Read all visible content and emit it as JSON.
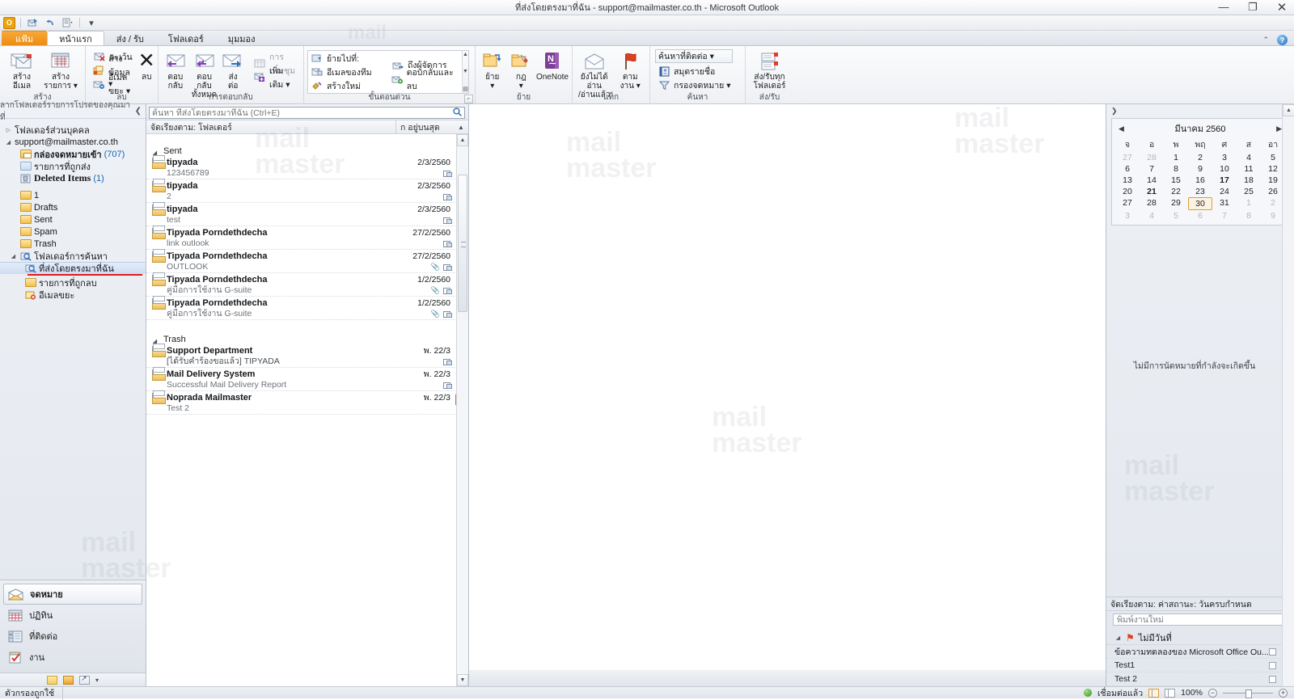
{
  "window": {
    "title": "ที่ส่งโดยตรงมาที่ฉัน - support@mailmaster.co.th - Microsoft Outlook",
    "minimize": "—",
    "maximize": "❐",
    "close": "✕",
    "help": "?",
    "ribbon_collapse": "⌃"
  },
  "qat": {
    "logo": "O",
    "save_icon": "save-icon",
    "undo_icon": "undo-icon",
    "sendreceive_icon": "send-receive-icon",
    "customize_icon": "customize-icon"
  },
  "tabs": [
    {
      "label": "แฟ้ม",
      "type": "file"
    },
    {
      "label": "หน้าแรก",
      "type": "active"
    },
    {
      "label": "ส่ง / รับ",
      "type": "normal"
    },
    {
      "label": "โฟลเดอร์",
      "type": "normal"
    },
    {
      "label": "มุมมอง",
      "type": "normal"
    }
  ],
  "ribbon": {
    "groups": [
      {
        "name": "สร้าง",
        "big": [
          {
            "label": "สร้าง\nอีเมล",
            "icon": "new-email-icon"
          },
          {
            "label": "สร้าง\nรายการ ▾",
            "icon": "new-items-icon"
          }
        ]
      },
      {
        "name": "ลบ",
        "small": [
          {
            "label": "ละเว้น",
            "icon": "ignore-icon"
          },
          {
            "label": "ล้างข้อมูล ▾",
            "icon": "cleanup-icon"
          },
          {
            "label": "อีเมลขยะ ▾",
            "icon": "junk-icon"
          }
        ],
        "big": [
          {
            "label": "ลบ",
            "icon": "delete-icon"
          }
        ]
      },
      {
        "name": "การตอบกลับ",
        "big": [
          {
            "label": "ตอบ\nกลับ",
            "icon": "reply-icon"
          },
          {
            "label": "ตอบกลับ\nทั้งหมด",
            "icon": "reply-all-icon"
          },
          {
            "label": "ส่ง\nต่อ",
            "icon": "forward-icon"
          }
        ],
        "small": [
          {
            "label": "การประชุม",
            "icon": "meeting-icon"
          },
          {
            "label": "เพิ่มเติม ▾",
            "icon": "more-icon"
          }
        ]
      },
      {
        "name": "ขั้นตอนด่วน",
        "quick_steps": [
          {
            "label": "ย้ายไปที่:",
            "icon": "move-to-icon"
          },
          {
            "label": "อีเมลของทีม",
            "icon": "team-email-icon"
          },
          {
            "label": "สร้างใหม่",
            "icon": "new-quickstep-icon"
          },
          {
            "label": "ถึงผู้จัดการ",
            "icon": "to-manager-icon"
          },
          {
            "label": "ตอบกลับและลบ",
            "icon": "reply-delete-icon"
          }
        ]
      },
      {
        "name": "ย้าย",
        "big": [
          {
            "label": "ย้าย\n▾",
            "icon": "move-icon"
          },
          {
            "label": "กฎ\n▾",
            "icon": "rules-icon"
          },
          {
            "label": "OneNote",
            "icon": "onenote-icon"
          }
        ]
      },
      {
        "name": "แท็ก",
        "big": [
          {
            "label": "ยังไม่ได้อ่าน\n/อ่านแล้ว",
            "icon": "unread-read-icon"
          },
          {
            "label": "ตาม\nงาน ▾",
            "icon": "follow-up-icon"
          }
        ]
      },
      {
        "name": "ค้นหา",
        "small": [
          {
            "label": "ค้นหาที่ติดต่อ ▾",
            "icon": "find-contact-icon"
          },
          {
            "label": "สมุดรายชื่อ",
            "icon": "address-book-icon"
          },
          {
            "label": "กรองจดหมาย ▾",
            "icon": "filter-email-icon"
          }
        ]
      },
      {
        "name": "ส่ง/รับ",
        "big": [
          {
            "label": "ส่ง/รับทุก\nโฟลเดอร์",
            "icon": "send-receive-all-icon"
          }
        ]
      }
    ]
  },
  "navpane": {
    "header": "ลากโฟลเดอร์รายการโปรดของคุณมาที่",
    "collapse": "❮",
    "tree": [
      {
        "label": "โฟลเดอร์ส่วนบุคคล",
        "indent": 0,
        "twisty": "▷",
        "icon": "none",
        "bold": false
      },
      {
        "label": "support@mailmaster.co.th",
        "indent": 0,
        "twisty": "◢",
        "icon": "none",
        "bold": false
      },
      {
        "label": "กล่องจดหมายเข้า",
        "count": "(707)",
        "indent": 1,
        "icon": "inbox-folder-icon",
        "bold": true
      },
      {
        "label": "รายการที่ถูกส่ง",
        "indent": 1,
        "icon": "sent-folder-icon",
        "bold": false
      },
      {
        "label": "Deleted Items",
        "count": "(1)",
        "indent": 1,
        "icon": "deleted-folder-icon",
        "bold": true,
        "serif": true
      },
      {
        "label": "1",
        "indent": 1,
        "icon": "folder-icon",
        "bold": false
      },
      {
        "label": "Drafts",
        "indent": 1,
        "icon": "folder-icon",
        "bold": false
      },
      {
        "label": "Sent",
        "indent": 1,
        "icon": "folder-icon",
        "bold": false
      },
      {
        "label": "Spam",
        "indent": 1,
        "icon": "folder-icon",
        "bold": false
      },
      {
        "label": "Trash",
        "indent": 1,
        "icon": "folder-icon",
        "bold": false
      },
      {
        "label": "โฟลเดอร์การค้นหา",
        "indent": 0,
        "twisty": "◢",
        "icon": "search-folder-icon",
        "bold": false
      },
      {
        "label": "ที่ส่งโดยตรงมาที่ฉัน",
        "indent": 1,
        "icon": "search-folder-icon",
        "bold": false,
        "selected": true
      },
      {
        "label": "รายการที่ถูกลบ",
        "indent": 1,
        "icon": "folder-icon",
        "bold": false
      },
      {
        "label": "อีเมลขยะ",
        "indent": 1,
        "icon": "junk-folder-icon",
        "bold": false
      }
    ],
    "modules": [
      {
        "label": "จดหมาย",
        "icon": "mail-module-icon",
        "active": true
      },
      {
        "label": "ปฏิทิน",
        "icon": "calendar-module-icon",
        "active": false
      },
      {
        "label": "ที่ติดต่อ",
        "icon": "contacts-module-icon",
        "active": false
      },
      {
        "label": "งาน",
        "icon": "tasks-module-icon",
        "active": false
      }
    ]
  },
  "list": {
    "search_placeholder": "ค้นหา ที่ส่งโดยตรงมาที่ฉัน (Ctrl+E)",
    "search_value": "",
    "sort_label": "จัดเรียงตาม: โฟลเดอร์",
    "sort_right": "ก อยู่บนสุด",
    "sort_arrow": "▲",
    "groups": [
      {
        "name": "Sent",
        "messages": [
          {
            "from": "tipyada",
            "subject": "123456789",
            "date": "2/3/2560",
            "attachment": false,
            "page": true,
            "flag": "off"
          },
          {
            "from": "tipyada",
            "subject": "2",
            "date": "2/3/2560",
            "attachment": false,
            "page": true,
            "flag": "off"
          },
          {
            "from": "tipyada",
            "subject": "test",
            "date": "2/3/2560",
            "attachment": false,
            "page": true,
            "flag": "off"
          },
          {
            "from": "Tipyada Porndethdecha",
            "subject": "link outlook",
            "date": "27/2/2560",
            "attachment": false,
            "page": true,
            "flag": "off"
          },
          {
            "from": "Tipyada Porndethdecha",
            "subject": "OUTLOOK",
            "date": "27/2/2560",
            "attachment": true,
            "page": true,
            "flag": "off"
          },
          {
            "from": "Tipyada Porndethdecha",
            "subject": "คู่มือการใช้งาน G-suite",
            "date": "1/2/2560",
            "attachment": true,
            "page": true,
            "flag": "off"
          },
          {
            "from": "Tipyada Porndethdecha",
            "subject": "คู่มือการใช้งาน G-suite",
            "date": "1/2/2560",
            "attachment": true,
            "page": true,
            "flag": "off"
          }
        ]
      },
      {
        "name": "Trash",
        "messages": [
          {
            "from": "Support Department",
            "subject": "[ได้รับคำร้องขอแล้ว] TIPYADA",
            "date": "พ. 22/3",
            "attachment": false,
            "page": true,
            "flag": "off"
          },
          {
            "from": "Mail Delivery System",
            "subject": "Successful Mail Delivery Report",
            "date": "พ. 22/3",
            "attachment": false,
            "page": true,
            "flag": "off"
          },
          {
            "from": "Noprada Mailmaster",
            "subject": "Test 2",
            "date": "พ. 22/3",
            "attachment": false,
            "page": false,
            "flag": "on"
          }
        ]
      }
    ]
  },
  "todobar": {
    "expand_icon": "❯",
    "calendar": {
      "month_label": "มีนาคม 2560",
      "prev": "◀",
      "next": "▶",
      "dow": [
        "จ",
        "อ",
        "พ",
        "พฤ",
        "ศ",
        "ส",
        "อา"
      ],
      "weeks": [
        [
          {
            "d": "27",
            "out": true
          },
          {
            "d": "28",
            "out": true
          },
          {
            "d": "1"
          },
          {
            "d": "2"
          },
          {
            "d": "3"
          },
          {
            "d": "4"
          },
          {
            "d": "5"
          }
        ],
        [
          {
            "d": "6"
          },
          {
            "d": "7"
          },
          {
            "d": "8"
          },
          {
            "d": "9"
          },
          {
            "d": "10"
          },
          {
            "d": "11"
          },
          {
            "d": "12"
          }
        ],
        [
          {
            "d": "13"
          },
          {
            "d": "14"
          },
          {
            "d": "15"
          },
          {
            "d": "16"
          },
          {
            "d": "17",
            "bold": true
          },
          {
            "d": "18"
          },
          {
            "d": "19"
          }
        ],
        [
          {
            "d": "20"
          },
          {
            "d": "21",
            "bold": true
          },
          {
            "d": "22"
          },
          {
            "d": "23"
          },
          {
            "d": "24"
          },
          {
            "d": "25"
          },
          {
            "d": "26"
          }
        ],
        [
          {
            "d": "27"
          },
          {
            "d": "28"
          },
          {
            "d": "29"
          },
          {
            "d": "30",
            "today": true
          },
          {
            "d": "31"
          },
          {
            "d": "1",
            "out": true
          },
          {
            "d": "2",
            "out": true
          }
        ],
        [
          {
            "d": "3",
            "out": true
          },
          {
            "d": "4",
            "out": true
          },
          {
            "d": "5",
            "out": true
          },
          {
            "d": "6",
            "out": true
          },
          {
            "d": "7",
            "out": true
          },
          {
            "d": "8",
            "out": true
          },
          {
            "d": "9",
            "out": true
          }
        ]
      ]
    },
    "appointments_empty": "ไม่มีการนัดหมายที่กำลังจะเกิดขึ้น",
    "task_sort": "จัดเรียงตาม: ค่าสถานะ: วันครบกำหนด",
    "task_sort_arrow": "▲",
    "new_task_placeholder": "พิมพ์งานใหม่",
    "task_group": "ไม่มีวันที่",
    "task_group_twisty": "◢",
    "tasks": [
      {
        "title": "ข้อความทดลองของ Microsoft Office Ou..."
      },
      {
        "title": "Test1"
      },
      {
        "title": "Test 2"
      }
    ]
  },
  "status": {
    "filter": "ตัวกรองถูกใช้",
    "connection": "เชื่อมต่อแล้ว",
    "zoom": "100%",
    "zoom_out": "−"
  },
  "watermark": {
    "line1": "mail",
    "line2": "master"
  }
}
